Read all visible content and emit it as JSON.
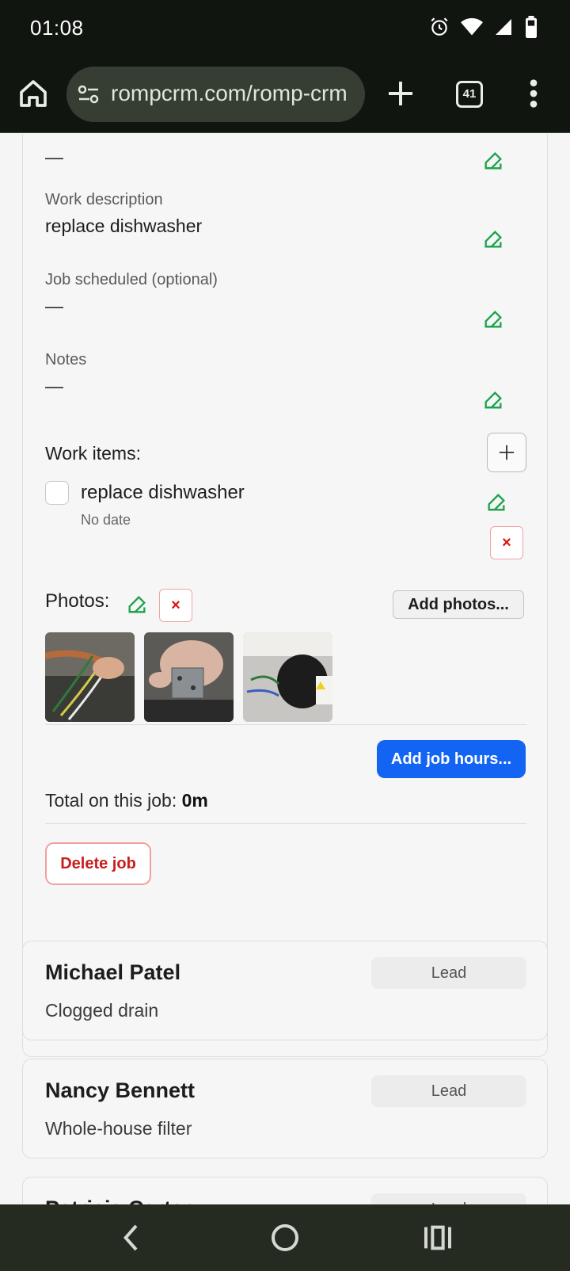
{
  "status_bar": {
    "time": "01:08"
  },
  "browser": {
    "url": "rompcrm.com/romp-crm",
    "tab_count": "41"
  },
  "job": {
    "top_value": "—",
    "fields": [
      {
        "label": "Work description",
        "value": "replace dishwasher"
      },
      {
        "label": "Job scheduled (optional)",
        "value": "—"
      },
      {
        "label": "Notes",
        "value": "—"
      }
    ],
    "work_items_title": "Work items:",
    "work_items": [
      {
        "label": "replace dishwasher",
        "date": "No date"
      }
    ],
    "photos_title": "Photos:",
    "add_photos_label": "Add photos...",
    "remove_symbol": "×",
    "add_hours_label": "Add job hours...",
    "total_label": "Total on this job: ",
    "total_value": "0m",
    "delete_label": "Delete job"
  },
  "leads": [
    {
      "name": "Michael Patel",
      "badge": "Lead",
      "description": "Clogged drain"
    },
    {
      "name": "Nancy Bennett",
      "badge": "Lead",
      "description": "Whole-house filter"
    },
    {
      "name": "Patricia Carter",
      "badge": "Lead",
      "description": ""
    }
  ],
  "colors": {
    "accent_blue": "#1464f4",
    "edit_green": "#1aa34a",
    "danger_red": "#d11111",
    "status_bg": "#101510",
    "nav_bg": "#262b22"
  }
}
